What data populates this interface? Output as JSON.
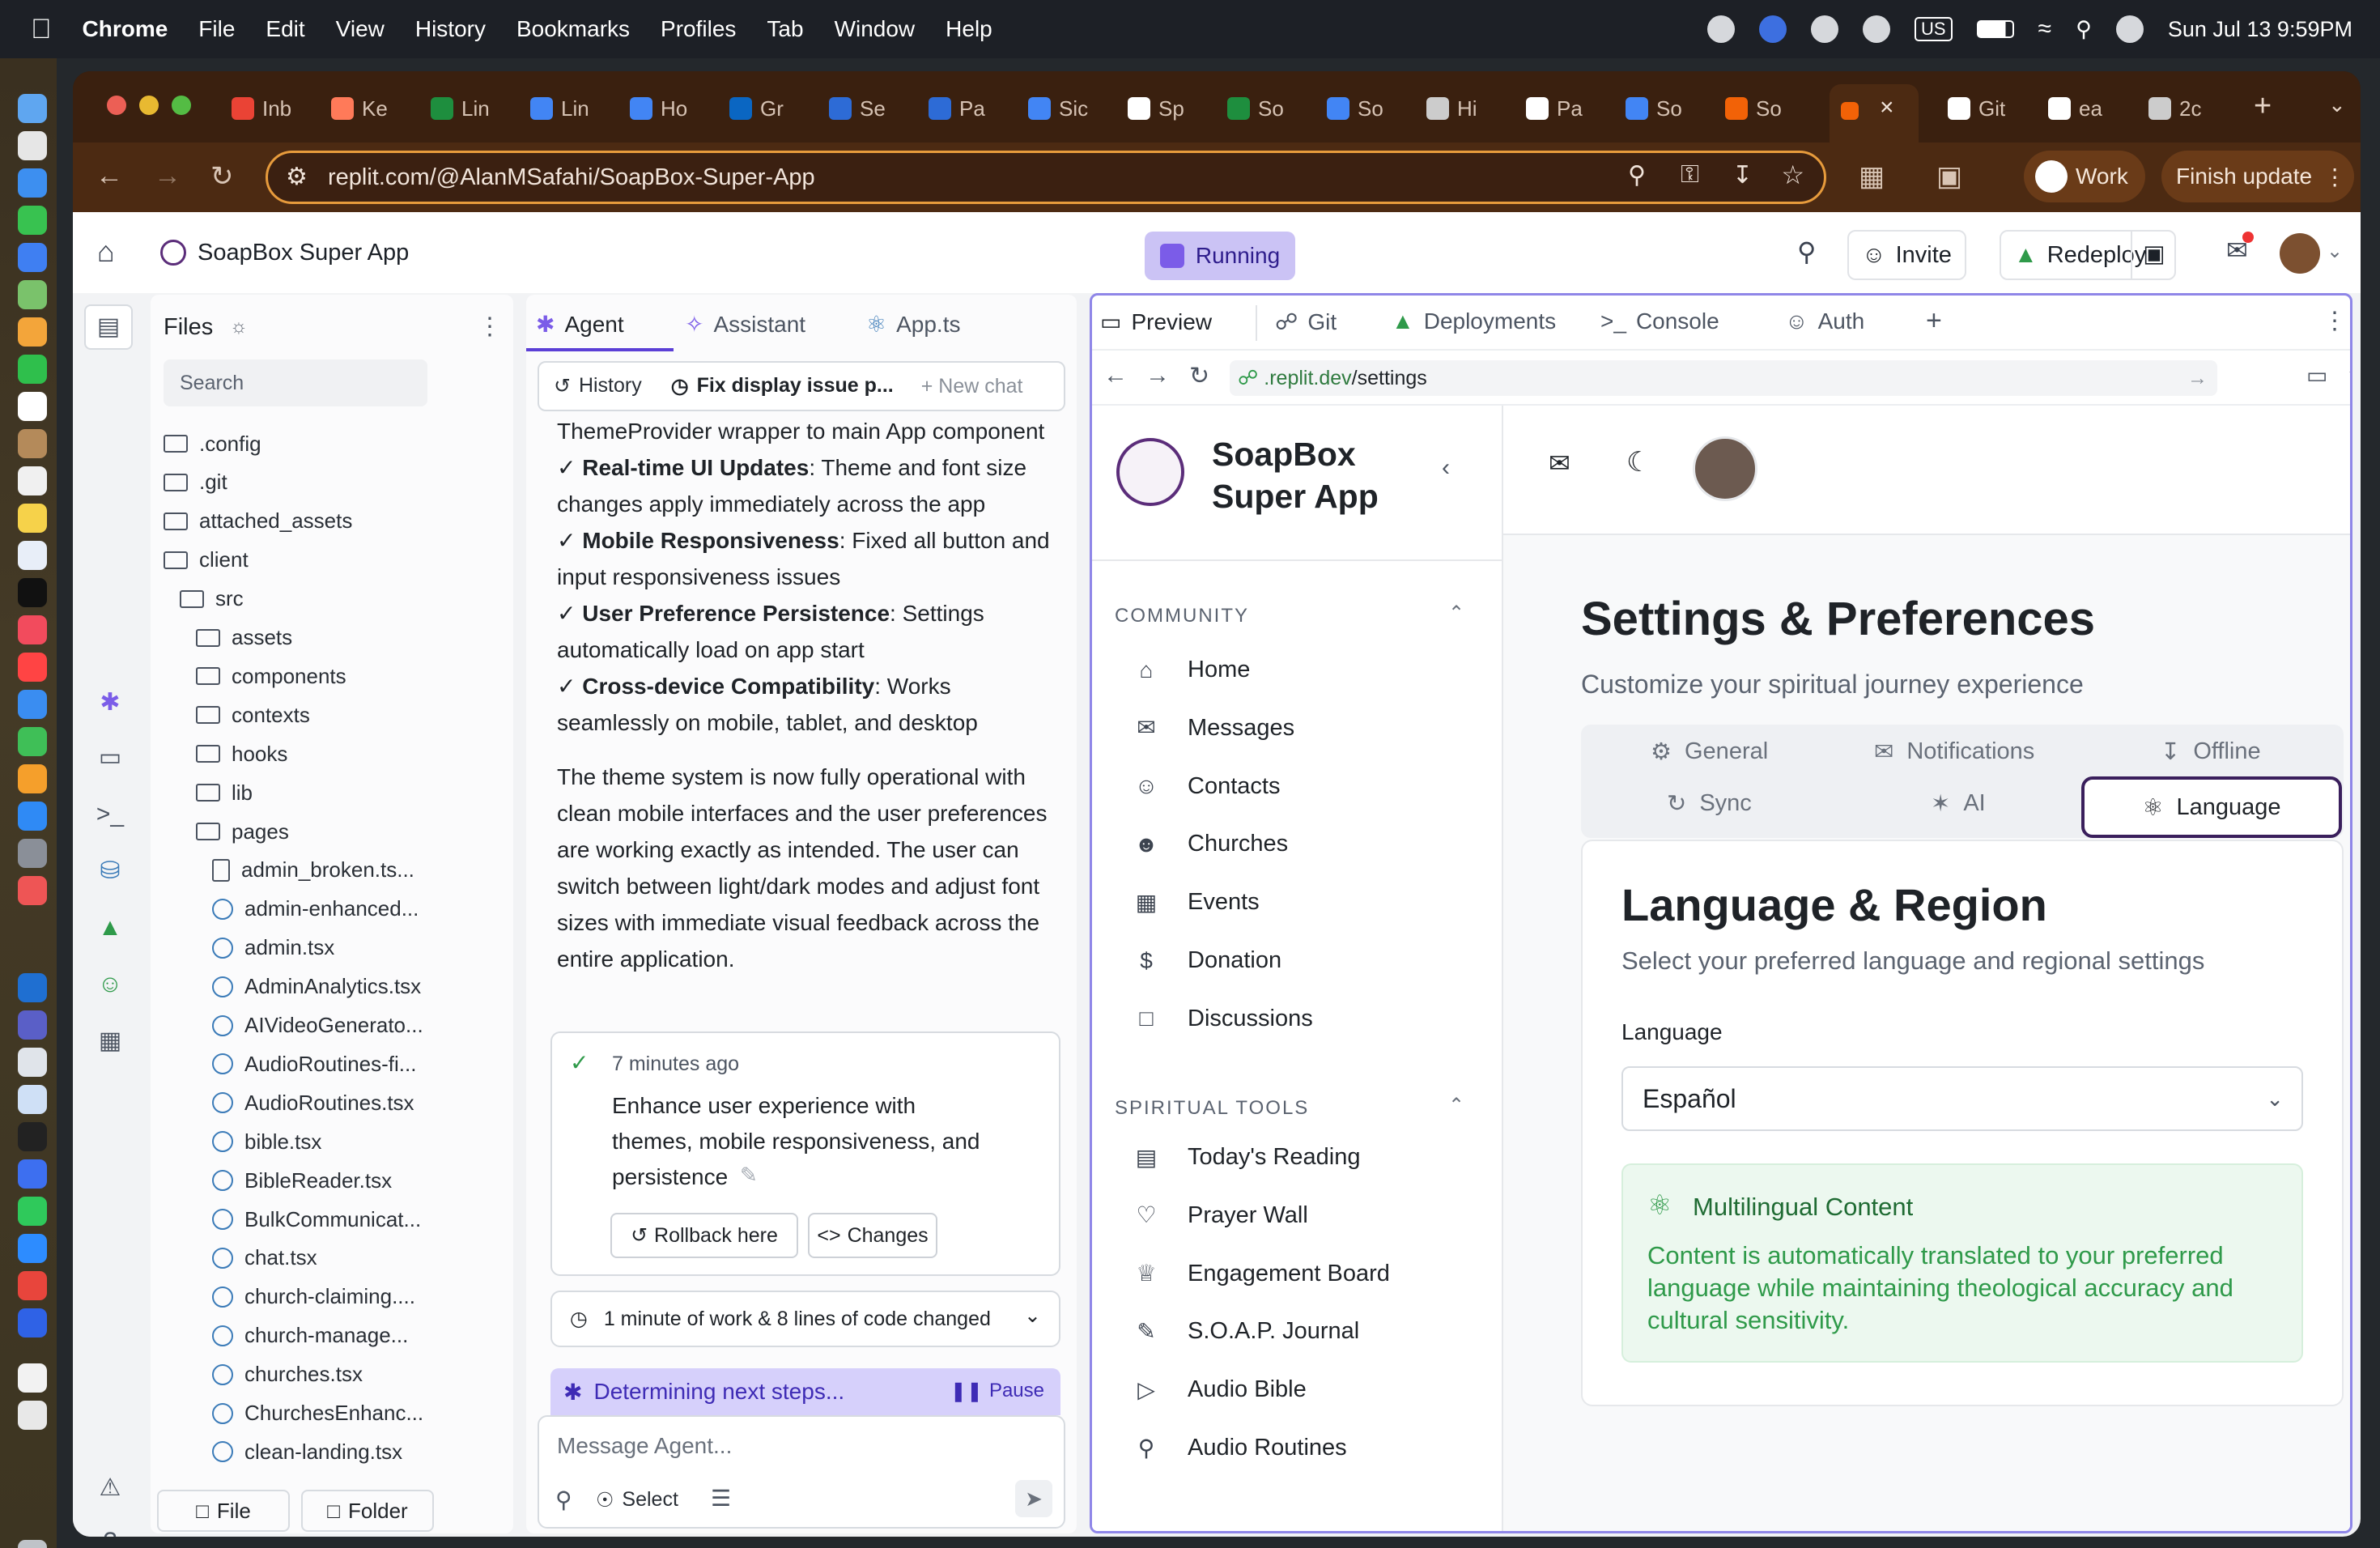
{
  "menubar": {
    "app": "Chrome",
    "items": [
      "File",
      "Edit",
      "View",
      "History",
      "Bookmarks",
      "Profiles",
      "Tab",
      "Window",
      "Help"
    ],
    "input_source": "US",
    "clock": "Sun Jul 13  9:59PM"
  },
  "browser": {
    "tabs": [
      "Inb",
      "Ke",
      "Lin",
      "Lin",
      "Ho",
      "Gr",
      "Se",
      "Pa",
      "Sic",
      "Sp",
      "So",
      "So",
      "Hi",
      "Pa",
      "So",
      "So",
      "",
      "Git",
      "ea",
      "2c"
    ],
    "url": "replit.com/@AlanMSafahi/SoapBox-Super-App",
    "profile": "Work",
    "finish_update": "Finish update"
  },
  "replit": {
    "project_name": "SoapBox Super App",
    "status": "Running",
    "invite": "Invite",
    "redeploy": "Redeploy"
  },
  "files": {
    "title": "Files",
    "search_placeholder": "Search",
    "tree": [
      ".config",
      ".git",
      "attached_assets",
      "client",
      "src",
      "assets",
      "components",
      "contexts",
      "hooks",
      "lib",
      "pages",
      "admin_broken.ts...",
      "admin-enhanced...",
      "admin.tsx",
      "AdminAnalytics.tsx",
      "AIVideoGenerato...",
      "AudioRoutines-fi...",
      "AudioRoutines.tsx",
      "bible.tsx",
      "BibleReader.tsx",
      "BulkCommunicat...",
      "chat.tsx",
      "church-claiming....",
      "church-manage...",
      "churches.tsx",
      "ChurchesEnhanc...",
      "clean-landing.tsx"
    ],
    "new_file": "File",
    "new_folder": "Folder"
  },
  "agent": {
    "tabs": [
      "Agent",
      "Assistant",
      "App.ts"
    ],
    "history": "History",
    "chat_title": "Fix display issue p...",
    "new_chat": "New chat",
    "line0": "ThemeProvider wrapper to main App component",
    "b1_title": "Real-time UI Updates",
    "b1_rest": ": Theme and font size changes apply immediately across the app",
    "b2_title": "Mobile Responsiveness",
    "b2_rest": ": Fixed all button and input responsiveness issues",
    "b3_title": "User Preference Persistence",
    "b3_rest": ": Settings automatically load on app start",
    "b4_title": "Cross-device Compatibility",
    "b4_rest": ": Works seamlessly on mobile, tablet, and desktop",
    "paragraph": "The theme system is now fully operational with clean mobile interfaces and the user preferences are working exactly as intended. The user can switch between light/dark modes and adjust font sizes with immediate visual feedback across the entire application.",
    "checkpoint_time": "7 minutes ago",
    "checkpoint_msg": "Enhance user experience with themes, mobile responsiveness, and persistence",
    "rollback": "Rollback here",
    "changes": "Changes",
    "work_summary": "1 minute of work & 8 lines of code changed",
    "status": "Determining next steps...",
    "pause": "Pause",
    "input_placeholder": "Message Agent...",
    "select": "Select"
  },
  "preview": {
    "tabs": [
      "Preview",
      "Git",
      "Deployments",
      "Console",
      "Auth"
    ],
    "url_prefix": ".replit.dev",
    "url_path": "/settings",
    "app_name_1": "SoapBox",
    "app_name_2": "Super App",
    "community_label": "COMMUNITY",
    "community": [
      "Home",
      "Messages",
      "Contacts",
      "Churches",
      "Events",
      "Donation",
      "Discussions"
    ],
    "tools_label": "SPIRITUAL TOOLS",
    "tools": [
      "Today's Reading",
      "Prayer Wall",
      "Engagement Board",
      "S.O.A.P. Journal",
      "Audio Bible",
      "Audio Routines"
    ],
    "page_title": "Settings & Preferences",
    "page_subtitle": "Customize your spiritual journey experience",
    "settings_tabs": [
      "General",
      "Notifications",
      "Offline",
      "Sync",
      "AI",
      "Language"
    ],
    "card_title": "Language & Region",
    "card_subtitle": "Select your preferred language and regional settings",
    "language_label": "Language",
    "language_value": "Español",
    "multi_title": "Multilingual Content",
    "multi_text": "Content is automatically translated to your preferred language while maintaining theological accuracy and cultural sensitivity."
  },
  "colors": {
    "accent": "#5b3fd6",
    "running_bg": "#cbc3f5",
    "success": "#2f9a4a",
    "success_bg": "#ecf8ef",
    "omnibox": "#e79b3c"
  }
}
